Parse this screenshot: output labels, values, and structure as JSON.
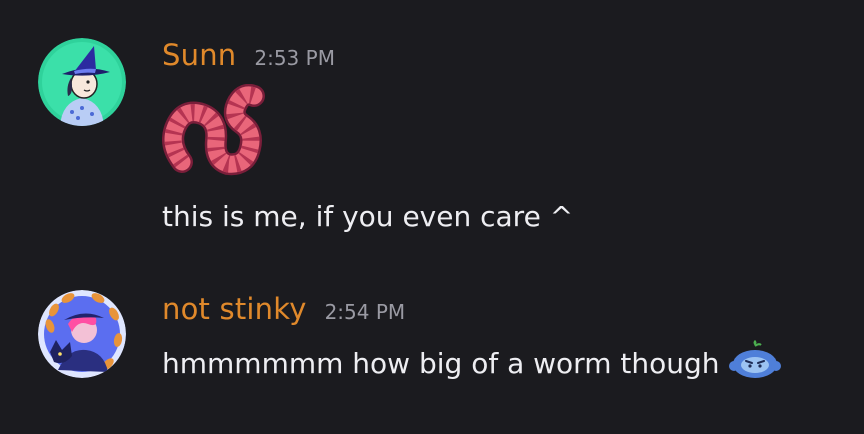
{
  "messages": [
    {
      "username": "Sunn",
      "username_color": "#e0892b",
      "timestamp": "2:53 PM",
      "sticker": "worm-sticker",
      "text": "this is me, if you even care ^",
      "avatar_bg": "#34d39b"
    },
    {
      "username": "not stinky",
      "username_color": "#e0892b",
      "timestamp": "2:54 PM",
      "text": "hmmmmmm how big of a worm though",
      "emoji": "grumpy-blue-bot-emoji",
      "avatar_bg": "#5b6ef0"
    }
  ]
}
